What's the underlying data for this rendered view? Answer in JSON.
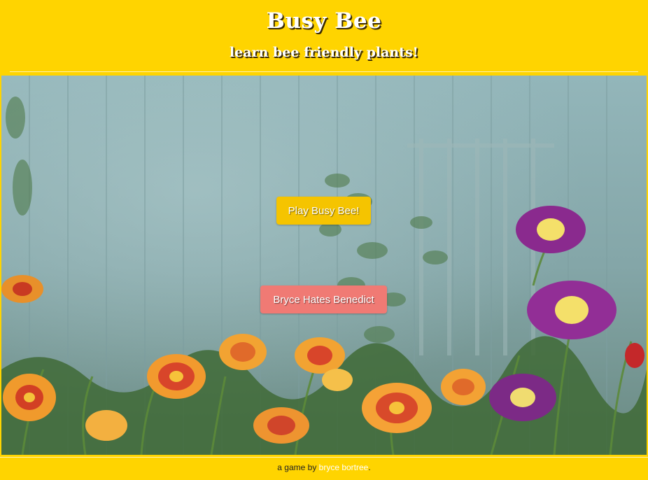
{
  "header": {
    "title": "Busy Bee",
    "subtitle": "learn bee friendly plants!"
  },
  "main": {
    "play_button": "Play Busy Bee!",
    "secondary_button": "Bryce Hates Benedict"
  },
  "footer": {
    "prefix": "a game by ",
    "author_link": "bryce bortree",
    "suffix": "."
  },
  "colors": {
    "brand_yellow": "#ffd400",
    "play_button": "#f5c400",
    "secondary_button": "#f07a74"
  }
}
